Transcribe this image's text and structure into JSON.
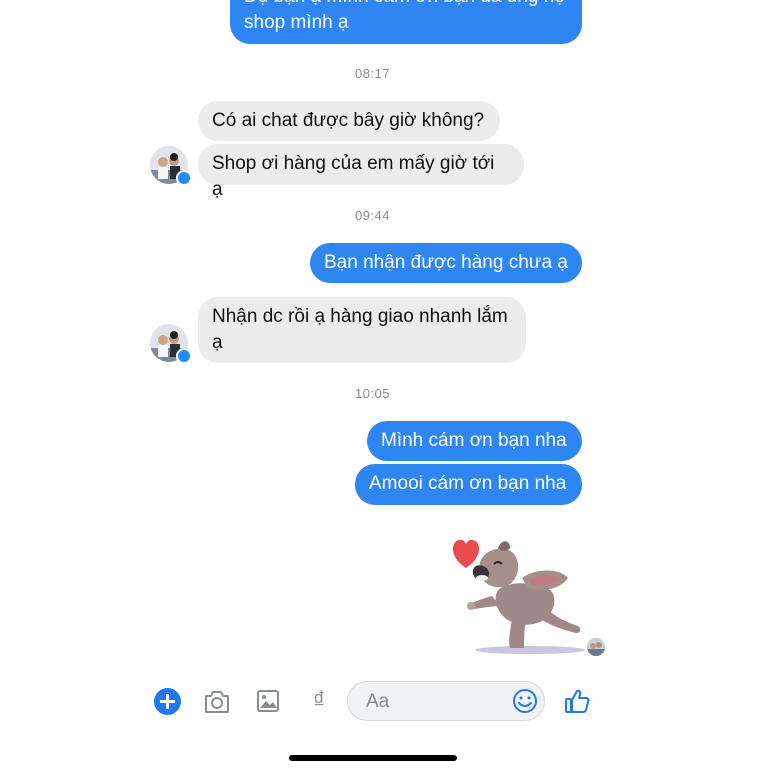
{
  "messages": {
    "top_partial_line": "Dụ bạn ạ mình cám ơn bạn đã ủng hộ",
    "top_partial_line2": "shop mình ạ",
    "time1": "08:17",
    "in1": "Có ai chat được bây giờ không?",
    "in2": "Shop ơi hàng của em mấy giờ tới ạ",
    "time2": "09:44",
    "out1": "Bạn nhận được hàng chưa ạ",
    "in3_line1": "Nhận dc rồi ạ hàng giao nhanh lắm",
    "in3_line2": "ạ",
    "time3": "10:05",
    "out2": "Mình cám ơn bạn nha",
    "out3": "Amooi cám ơn bạn nha"
  },
  "composer": {
    "placeholder": "Aa",
    "currency_glyph": "₫"
  },
  "icons": {
    "plus": "plus-icon",
    "camera": "camera-icon",
    "gallery": "image-icon",
    "payment": "dong-icon",
    "emoji": "emoji-icon",
    "like": "thumbs-up-icon",
    "sticker": "dog-heart-sticker"
  },
  "colors": {
    "accent": "#2d86f2",
    "incoming_bubble": "#ececec",
    "timestamp": "#8a8d91"
  }
}
